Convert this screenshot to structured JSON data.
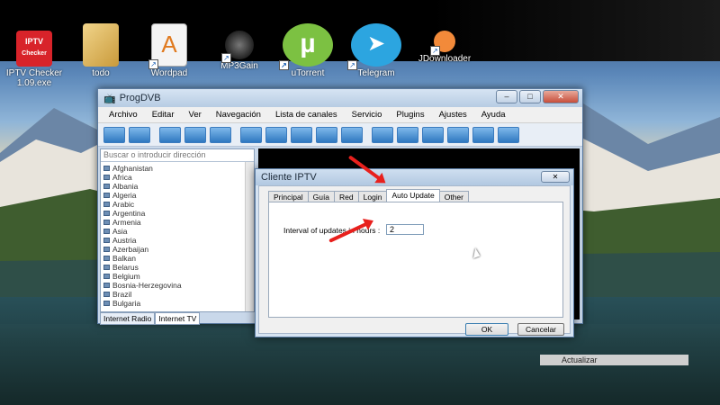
{
  "desktop_icons": [
    {
      "name": "iptv-checker",
      "label": "IPTV Checker\n1.09.exe",
      "badge": "IPTV\nChecker"
    },
    {
      "name": "todo",
      "label": "todo"
    },
    {
      "name": "wordpad",
      "label": "Wordpad"
    },
    {
      "name": "mp3gain",
      "label": "MP3Gain"
    },
    {
      "name": "utorrent",
      "label": "uTorrent"
    },
    {
      "name": "telegram",
      "label": "Telegram"
    },
    {
      "name": "jdownloader",
      "label": "JDownloader"
    }
  ],
  "progdvb": {
    "title": "ProgDVB",
    "menu": [
      "Archivo",
      "Editar",
      "Ver",
      "Navegación",
      "Lista de canales",
      "Servicio",
      "Plugins",
      "Ajustes",
      "Ayuda"
    ],
    "search_placeholder": "Buscar o introducir dirección",
    "countries": [
      "Afghanistan",
      "Africa",
      "Albania",
      "Algeria",
      "Arabic",
      "Argentina",
      "Armenia",
      "Asia",
      "Austria",
      "Azerbaijan",
      "Balkan",
      "Belarus",
      "Belgium",
      "Bosnia-Herzegovina",
      "Brazil",
      "Bulgaria"
    ],
    "bottom_tabs": [
      "Internet Radio",
      "Internet TV"
    ],
    "window_buttons": {
      "minimize": "–",
      "maximize": "□",
      "close": "✕"
    }
  },
  "dialog": {
    "title": "Cliente IPTV",
    "tabs": [
      "Principal",
      "Guía",
      "Red",
      "Login",
      "Auto Update",
      "Other"
    ],
    "active_tab": "Auto Update",
    "interval_label": "Interval of updates in hours :",
    "interval_value": "2",
    "ok_label": "OK",
    "cancel_label": "Cancelar",
    "close_symbol": "✕"
  },
  "context_menu": {
    "item": "Actualizar"
  },
  "colors": {
    "arrow": "#e8201d",
    "accent": "#2f78c0"
  }
}
